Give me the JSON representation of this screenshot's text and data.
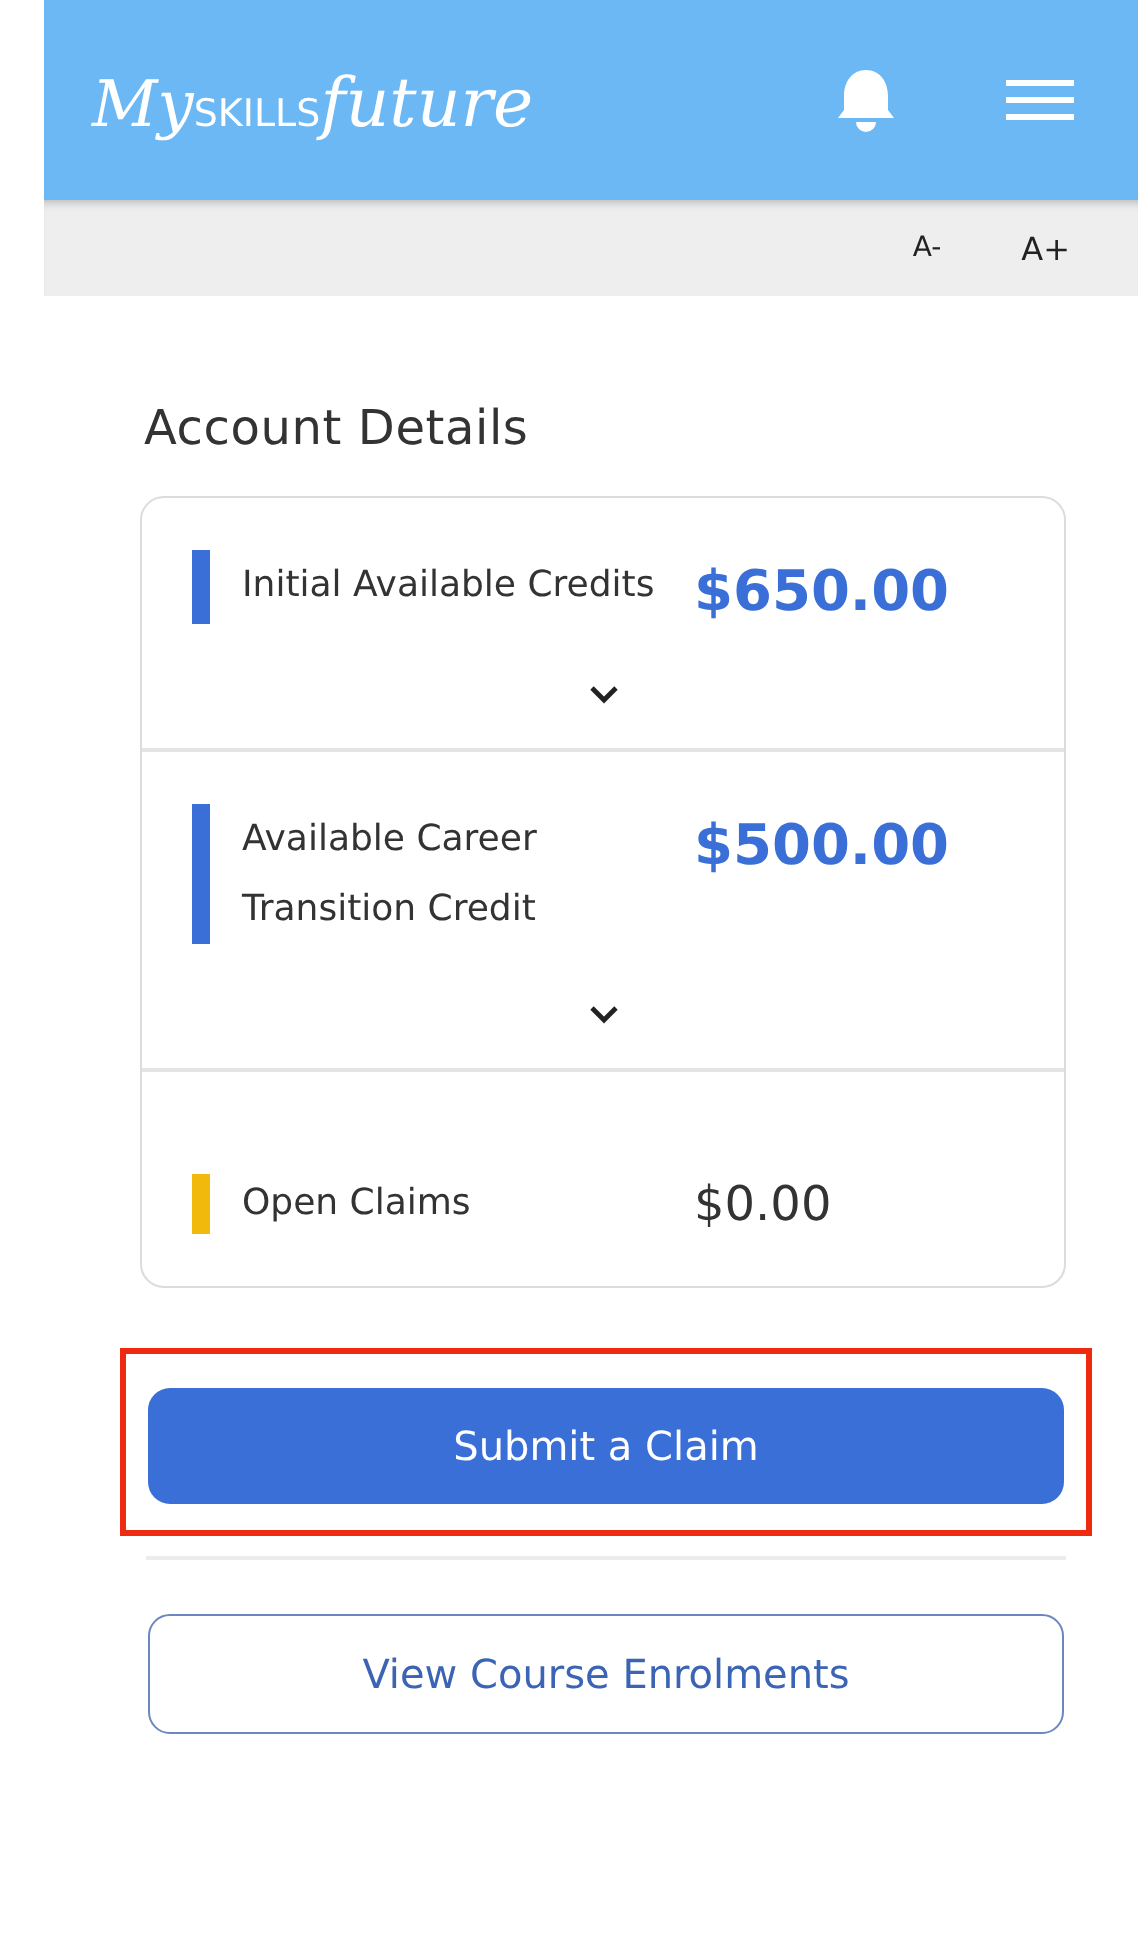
{
  "header": {
    "logo": {
      "part_1": "My",
      "part_2": "SKILLS",
      "part_3": "future"
    }
  },
  "font_controls": [
    "A-",
    "A+"
  ],
  "account": {
    "title": "Account Details",
    "items": [
      {
        "kind": "expandable",
        "label": "Initial Available Credits",
        "amount": "$650.00",
        "color": "#3a6fd8",
        "expanded": false
      },
      {
        "kind": "expandable",
        "label": "Available Career Transition Credit",
        "amount": "$500.00",
        "color": "#3a6fd8",
        "expanded": false
      },
      {
        "kind": "plain",
        "label": "Open Claims",
        "amount": "$0.00",
        "color": "#f0b90b"
      }
    ]
  },
  "actions": [
    {
      "kind": "primary",
      "label": "Submit a Claim",
      "highlighted": true
    },
    {
      "kind": "outline",
      "label": "View Course Enrolments",
      "highlighted": false
    }
  ]
}
